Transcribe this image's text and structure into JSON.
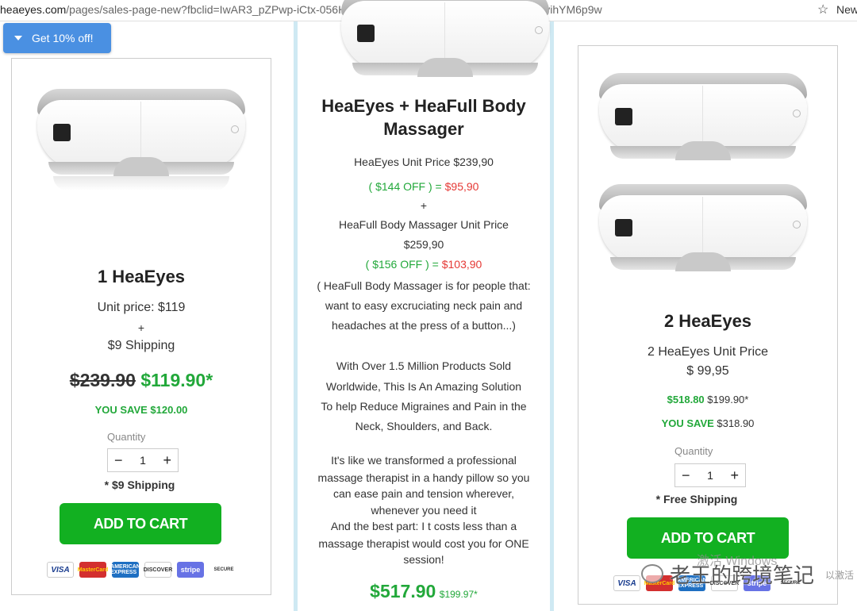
{
  "browser": {
    "url_domain": "heaeyes.com",
    "url_path": "/pages/sales-page-new?fbclid=IwAR3_pZPwp-iCtx-056HNUDSHYI2wgPqf-angA558bjXEVyJEHhvihYM6p9w",
    "new_label": "New"
  },
  "discount_tab": {
    "label": "Get 10% off!"
  },
  "left": {
    "title": "1 HeaEyes",
    "unit_price": "Unit price: $119",
    "plus": "+",
    "shipping": "$9 Shipping",
    "old_price": "$239.90",
    "new_price": "$119.90*",
    "you_save": "YOU SAVE $120.00",
    "qty_label": "Quantity",
    "qty_value": "1",
    "shipping_note": "* $9  Shipping",
    "cart": "ADD TO CART"
  },
  "middle": {
    "title_l1": "HeaEyes +  HeaFull Body",
    "title_l2": "Massager",
    "unit1": "HeaEyes Unit Price $239,90",
    "off1_green": "( $144 OFF ) =",
    "off1_red": "$95,90",
    "plus": "+",
    "unit2_l1": "HeaFull Body Massager Unit Price",
    "unit2_l2": "$259,90",
    "off2_green": "( $156 OFF ) =",
    "off2_red": "$103,90",
    "desc1": "( HeaFull Body Massager is for people that:",
    "desc2": "want to easy excruciating neck pain and",
    "desc3": "headaches at the press of a button...)",
    "p2_l1": "With Over 1.5 Million Products Sold",
    "p2_l2": "Worldwide,  This Is An Amazing Solution",
    "p2_l3": "To help Reduce Migraines and Pain in the",
    "p2_l4": "Neck, Shoulders, and Back.",
    "p3_l1": "It's like we transformed a professional",
    "p3_l2": "massage therapist in a handy pillow so you",
    "p3_l3": "can ease pain and tension wherever,",
    "p3_l4": "whenever you need it",
    "p3_l5": "And the best part: I t costs less than a",
    "p3_l6": "massage therapist would cost you for ONE",
    "p3_l7": "session!",
    "price": "$517.90",
    "price_small": "$199.97*"
  },
  "right": {
    "title": "2 HeaEyes",
    "unit_l1": "2 HeaEyes Unit Price",
    "unit_l2": "$ 99,95",
    "price_green": "$518.80",
    "price_old": "$199.90*",
    "you_save_label": "YOU SAVE",
    "you_save_value": "$318.90",
    "qty_label": "Quantity",
    "qty_value": "1",
    "shipping_note": "* Free Shipping",
    "cart": "ADD TO CART"
  },
  "payments": {
    "visa": "VISA",
    "mastercard": "MasterCard",
    "amex": "AMERICAN EXPRESS",
    "discover": "DISCOVER",
    "stripe": "stripe",
    "secure": "SECURE"
  },
  "steppers": {
    "minus": "−",
    "plus": "+"
  },
  "overlay": {
    "activate_windows": "激活 Windows",
    "wechat_account": "老王的跨境笔记",
    "tail": "以激活"
  },
  "colors": {
    "green": "#22a83a",
    "red": "#e53935",
    "cart_button": "#12b021",
    "tab_blue": "#4a90e2"
  }
}
